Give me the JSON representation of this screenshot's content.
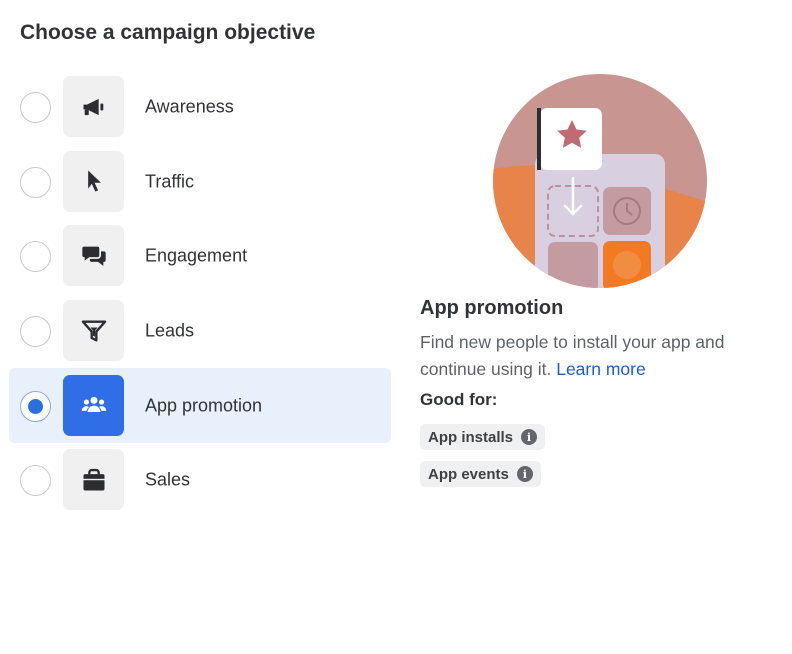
{
  "title": "Choose a campaign objective",
  "objectives": [
    {
      "label": "Awareness",
      "icon": "megaphone-icon",
      "selected": false
    },
    {
      "label": "Traffic",
      "icon": "cursor-icon",
      "selected": false
    },
    {
      "label": "Engagement",
      "icon": "chat-bubbles-icon",
      "selected": false
    },
    {
      "label": "Leads",
      "icon": "funnel-icon",
      "selected": false
    },
    {
      "label": "App promotion",
      "icon": "people-group-icon",
      "selected": true
    },
    {
      "label": "Sales",
      "icon": "shopping-bag-icon",
      "selected": false
    }
  ],
  "detail": {
    "title": "App promotion",
    "description": "Find new people to install your app and continue using it.",
    "learn_more": "Learn more",
    "good_for_label": "Good for:",
    "good_for": [
      {
        "label": "App installs",
        "icon": "info-icon"
      },
      {
        "label": "App events",
        "icon": "info-icon"
      }
    ]
  },
  "colors": {
    "accent": "#2f6ee6",
    "selected_row_bg": "#e8f0fc",
    "link": "#1d5bd6"
  }
}
